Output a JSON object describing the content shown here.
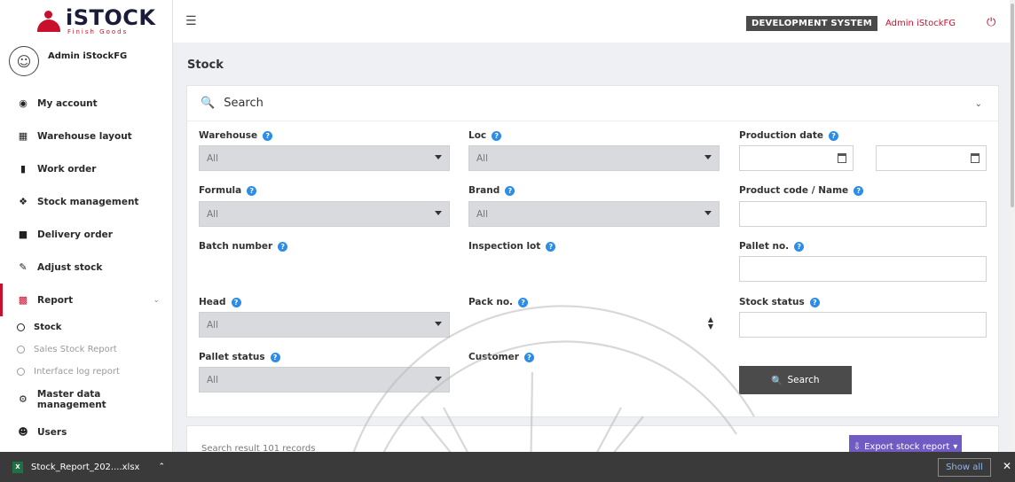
{
  "app": {
    "brand": "iSTOCK",
    "brand_sub": "Finish Goods",
    "user_name": "Admin iStockFG"
  },
  "topbar": {
    "environment_badge": "DEVELOPMENT SYSTEM",
    "user_link": "Admin iStockFG",
    "power_icon": "power-icon"
  },
  "sidebar": {
    "items": [
      {
        "label": "My account",
        "icon": "user-circle-icon"
      },
      {
        "label": "Warehouse layout",
        "icon": "grid-icon"
      },
      {
        "label": "Work order",
        "icon": "list-icon"
      },
      {
        "label": "Stock management",
        "icon": "cubes-icon"
      },
      {
        "label": "Delivery order",
        "icon": "truck-icon"
      },
      {
        "label": "Adjust stock",
        "icon": "edit-icon"
      },
      {
        "label": "Report",
        "icon": "chart-icon"
      }
    ],
    "report_children": [
      "Stock",
      "Sales Stock Report",
      "Interface log report"
    ],
    "bottom_items": [
      {
        "label": "Master data management",
        "icon": "cogs-icon"
      },
      {
        "label": "Users",
        "icon": "users-icon"
      }
    ],
    "accent_color": "#c8102e"
  },
  "page": {
    "title": "Stock"
  },
  "search": {
    "header": "Search",
    "fields": {
      "warehouse": {
        "label": "Warehouse",
        "value": "All"
      },
      "loc": {
        "label": "Loc",
        "value": "All"
      },
      "production_date": {
        "label": "Production date",
        "from": "",
        "to": ""
      },
      "formula": {
        "label": "Formula",
        "value": "All"
      },
      "brand": {
        "label": "Brand",
        "value": "All"
      },
      "product_code": {
        "label": "Product code / Name",
        "value": ""
      },
      "batch_number": {
        "label": "Batch number",
        "value": ""
      },
      "inspection_lot": {
        "label": "Inspection lot",
        "value": ""
      },
      "pallet_no": {
        "label": "Pallet no.",
        "value": ""
      },
      "head": {
        "label": "Head",
        "value": "All"
      },
      "pack_no": {
        "label": "Pack no.",
        "value": ""
      },
      "stock_status": {
        "label": "Stock status",
        "value": ""
      },
      "pallet_status": {
        "label": "Pallet status",
        "value": "All"
      },
      "customer": {
        "label": "Customer",
        "value": ""
      }
    },
    "button": "Search"
  },
  "results": {
    "summary": "Search result 101 records",
    "export_button": "Export stock report"
  },
  "download_bar": {
    "file_name": "Stock_Report_202....xlsx",
    "show_all": "Show all"
  }
}
